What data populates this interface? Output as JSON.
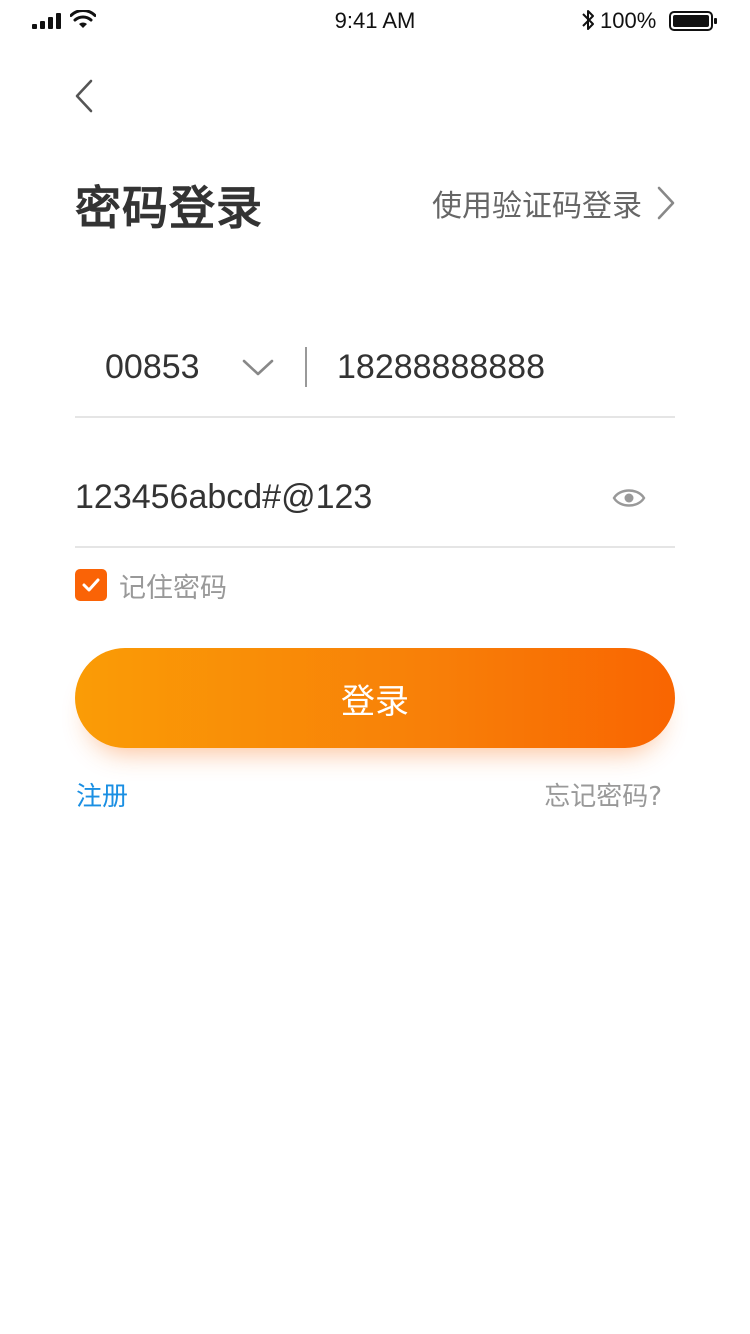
{
  "status_bar": {
    "time": "9:41 AM",
    "battery": "100%"
  },
  "header": {
    "title": "密码登录",
    "switch_link": "使用验证码登录"
  },
  "form": {
    "country_code": "00853",
    "phone": "18288888888",
    "password": "123456abcd#@123",
    "remember_label": "记住密码",
    "remember_checked": true,
    "login_button": "登录"
  },
  "footer": {
    "register": "注册",
    "forgot": "忘记密码?"
  },
  "colors": {
    "accent": "#fa6306",
    "gradient_start": "#fa9c06",
    "gradient_end": "#f96501",
    "link_blue": "#1a8fe3",
    "text_primary": "#333333",
    "text_secondary": "#999999"
  },
  "icons": [
    "signal-icon",
    "wifi-icon",
    "bluetooth-icon",
    "battery-icon",
    "back-chevron-icon",
    "chevron-right-icon",
    "chevron-down-icon",
    "eye-icon",
    "check-icon"
  ]
}
